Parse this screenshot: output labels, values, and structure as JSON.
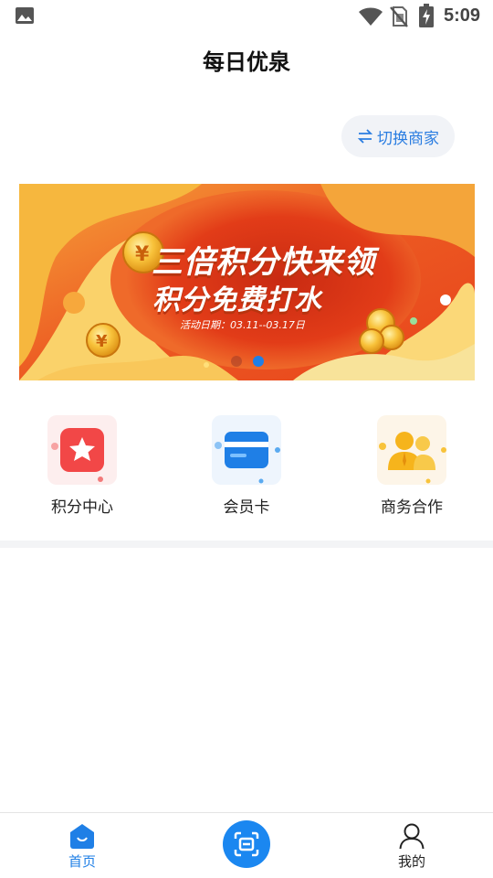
{
  "status_bar": {
    "time": "5:09",
    "icons": [
      "image-icon",
      "wifi-icon",
      "no-sim-icon",
      "battery-charging-icon"
    ]
  },
  "header": {
    "title": "每日优泉"
  },
  "switch_merchant": {
    "label": "切换商家",
    "icon": "swap-icon"
  },
  "banner": {
    "headline_1": "三倍积分快来领",
    "headline_2": "积分免费打水",
    "date_text": "活动日期：03.11--03.17日",
    "slide_count": 2,
    "active_slide": 2,
    "colors": {
      "primary": "#e8431c",
      "accent": "#f5b83a"
    }
  },
  "quick_menu": [
    {
      "label": "积分中心",
      "icon": "star-icon"
    },
    {
      "label": "会员卡",
      "icon": "card-icon"
    },
    {
      "label": "商务合作",
      "icon": "partners-icon"
    }
  ],
  "bottom_nav": {
    "home_label": "首页",
    "scan_icon": "scan-icon",
    "mine_label": "我的",
    "active_tab": "home",
    "active_color": "#1f7fe6"
  }
}
